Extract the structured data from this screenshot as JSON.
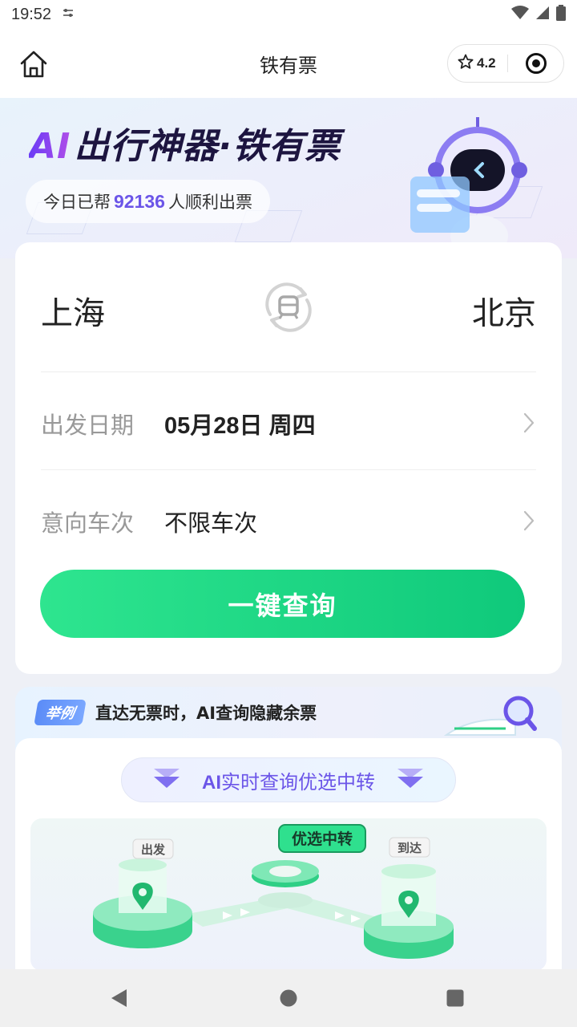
{
  "status_bar": {
    "time": "19:52",
    "notification_icon": "settings-sliders-icon",
    "icons": [
      "wifi-icon",
      "signal-icon",
      "battery-icon"
    ]
  },
  "navbar": {
    "title": "铁有票",
    "rating": "4.2",
    "home_icon": "home-icon",
    "rating_icon": "star-icon",
    "capsule_icon": "target-icon"
  },
  "hero": {
    "title_ai": "AI",
    "title_rest": "出行神器·铁有票",
    "help_prefix": "今日已帮",
    "help_count": "92136",
    "help_suffix": "人顺利出票"
  },
  "search": {
    "from_city": "上海",
    "to_city": "北京",
    "date_label": "出发日期",
    "date_value": "05月28日 周四",
    "train_label": "意向车次",
    "train_value": "不限车次",
    "query_button": "一键查询"
  },
  "promo": {
    "tag": "举例",
    "headline": "直达无票时，AI查询隐藏余票",
    "subtitle_ai": "AI",
    "subtitle_rest": "实时查询优选中转",
    "depart_label": "出发",
    "transfer_label": "优选中转",
    "arrive_label": "到达"
  },
  "colors": {
    "primary_green": "#12cc7e",
    "accent_purple": "#6b55e8",
    "tag_blue": "#5b8cf7"
  }
}
